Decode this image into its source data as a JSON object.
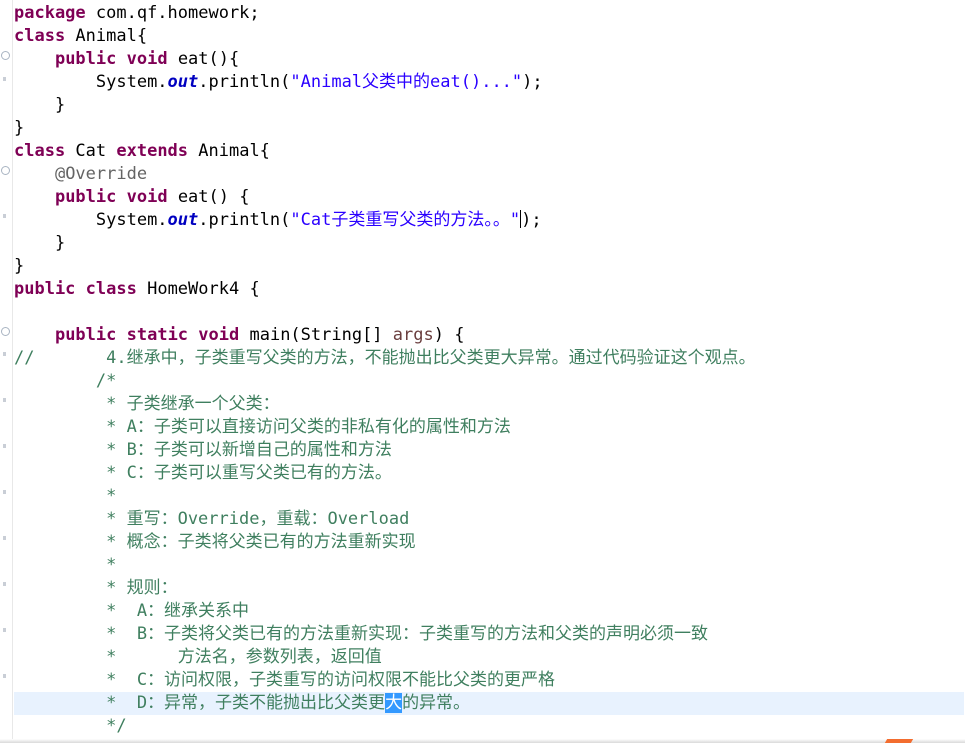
{
  "code": {
    "package_kw": "package",
    "package_name": " com.qf.homework;",
    "class_kw": "class",
    "animal_decl": " Animal{",
    "public_kw": "public",
    "void_kw": "void",
    "eat_sig": " eat(){",
    "eat_sig2": " eat() {",
    "system_prefix": "System.",
    "out_field": "out",
    "println_call": ".println(",
    "animal_str": "\"Animal父类中的eat()...\"",
    "call_end": ");",
    "close_brace": "}",
    "cat_name": " Cat ",
    "extends_kw": "extends",
    "animal_open": " Animal{",
    "override_ann": "@Override",
    "cat_str_pre": "\"Cat子类重写父类的方法。。",
    "cat_str_quote": "\"",
    "homework_decl": " HomeWork4 {",
    "static_kw": "static",
    "main_sig_pre": " main(String[] ",
    "args_name": "args",
    "main_sig_post": ") {",
    "line_comment": "//       4.继承中，子类重写父类的方法，不能抛出比父类更大异常。通过代码验证这个观点。",
    "c_open": "        /*",
    "c1": "         * 子类继承一个父类：",
    "c2": "         * A：子类可以直接访问父类的非私有化的属性和方法",
    "c3": "         * B：子类可以新增自己的属性和方法",
    "c4": "         * C：子类可以重写父类已有的方法。",
    "c5": "         *",
    "c6": "         * 重写：Override，重载：Overload",
    "c7": "         * 概念：子类将父类已有的方法重新实现",
    "c8": "         *",
    "c9": "         * 规则：",
    "c10": "         *  A：继承关系中",
    "c11": "         *  B：子类将父类已有的方法重新实现：子类重写的方法和父类的声明必须一致",
    "c12": "         *      方法名，参数列表，返回值",
    "c13": "         *  C：访问权限，子类重写的访问权限不能比父类的更严格",
    "c14_pre": "         *  D：异常，子类不能抛出比父类更",
    "c14_sel": "大",
    "c14_post": "的异常。",
    "c_close": "         */"
  }
}
